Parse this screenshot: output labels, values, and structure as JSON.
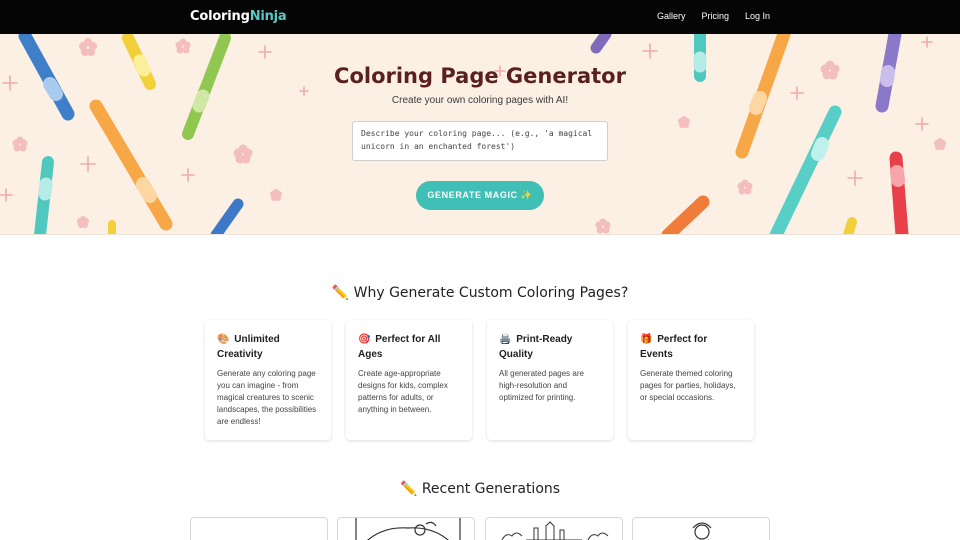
{
  "nav": {
    "logo_part1": "Coloring",
    "logo_part2": "Ninja",
    "links": [
      "Gallery",
      "Pricing",
      "Log In"
    ]
  },
  "hero": {
    "title": "Coloring Page Generator",
    "subtitle": "Create your own coloring pages with AI!",
    "prompt_placeholder": "Describe your coloring page... (e.g., 'a magical unicorn in an enchanted forest')",
    "button_label": "GENERATE MAGIC ✨"
  },
  "why": {
    "title_icon": "✏️",
    "title": "Why Generate Custom Coloring Pages?",
    "cards": [
      {
        "icon": "🎨",
        "title": "Unlimited Creativity",
        "text": "Generate any coloring page you can imagine - from magical creatures to scenic landscapes, the possibilities are endless!"
      },
      {
        "icon": "🎯",
        "title": "Perfect for All Ages",
        "text": "Create age-appropriate designs for kids, complex patterns for adults, or anything in between."
      },
      {
        "icon": "🖨️",
        "title": "Print-Ready Quality",
        "text": "All generated pages are high-resolution and optimized for printing."
      },
      {
        "icon": "🎁",
        "title": "Perfect for Events",
        "text": "Generate themed coloring pages for parties, holidays, or special occasions."
      }
    ]
  },
  "recent": {
    "title_icon": "✏️",
    "title": "Recent Generations"
  },
  "colors": {
    "nav_bg": "#050505",
    "accent_teal": "#3fbfb5",
    "logo_accent": "#58c9c4",
    "hero_bg": "#fcf0e5",
    "title_color": "#5a1f1f"
  }
}
